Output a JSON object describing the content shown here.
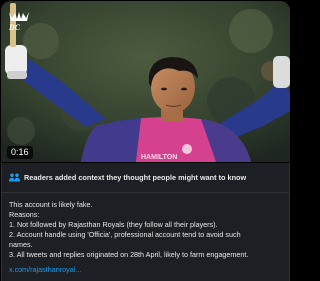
{
  "video": {
    "duration": "0:16",
    "jersey_text": "HAMILTON"
  },
  "note": {
    "header": "Readers added context they thought people might want to know",
    "lines": [
      "This account is likely fake.",
      "Reasons:",
      "1. Not followed by Rajasthan Royals (they follow all their players).",
      "2. Account handle using 'Officia', professional account tend to avoid such",
      "names.",
      "3. All tweets and replies originated on 28th April, likely to farm engagement."
    ],
    "link": "x.com/rajasthanroyal..."
  },
  "colors": {
    "link": "#1d9bf0",
    "note_background": "#1c1f23",
    "jersey_pink": "#d6418f",
    "jersey_blue": "#283a8c"
  }
}
